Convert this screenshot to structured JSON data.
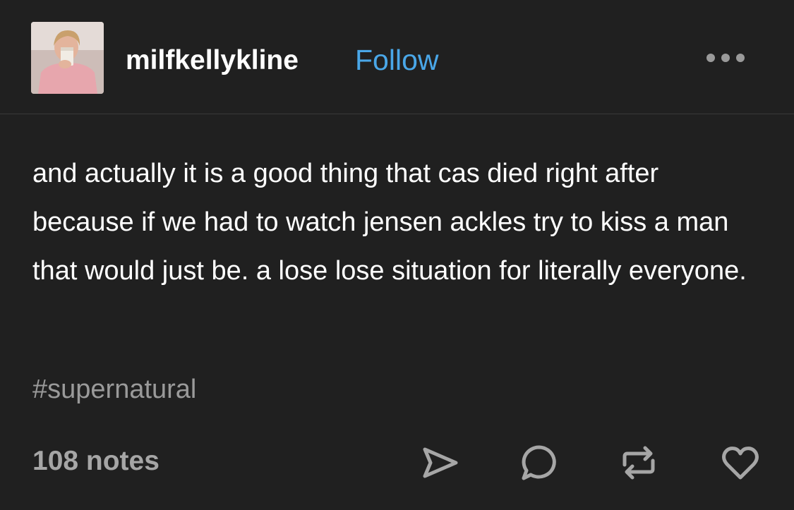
{
  "post": {
    "username": "milfkellykline",
    "follow_label": "Follow",
    "body": "and actually it is a good thing that cas died right after because if we had to watch jensen ackles try to kiss a man that would just be. a lose lose situation for literally everyone.",
    "tag": "#supernatural",
    "notes": "108 notes"
  },
  "icons": {
    "more": "more-options-icon",
    "share": "share-icon",
    "reply": "reply-icon",
    "reblog": "reblog-icon",
    "like": "heart-icon"
  },
  "colors": {
    "background": "#202020",
    "text": "#ffffff",
    "link": "#4aa7e8",
    "muted": "#9a9a9a"
  }
}
